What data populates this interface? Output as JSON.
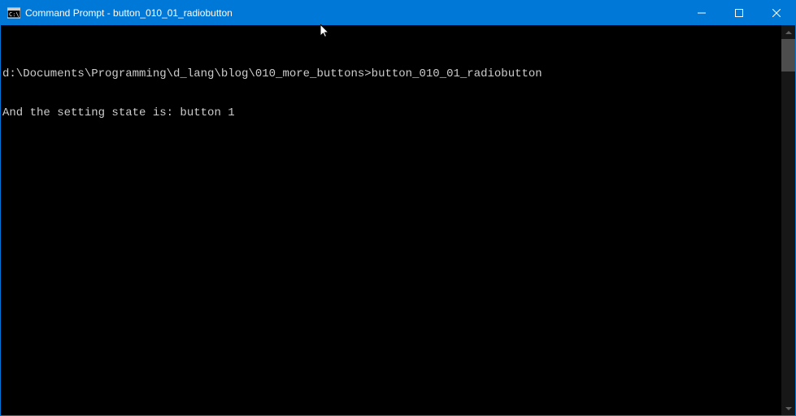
{
  "titlebar": {
    "title": "Command Prompt - button_010_01_radiobutton"
  },
  "terminal": {
    "lines": [
      "d:\\Documents\\Programming\\d_lang\\blog\\010_more_buttons>button_010_01_radiobutton",
      "And the setting state is: button 1"
    ]
  }
}
